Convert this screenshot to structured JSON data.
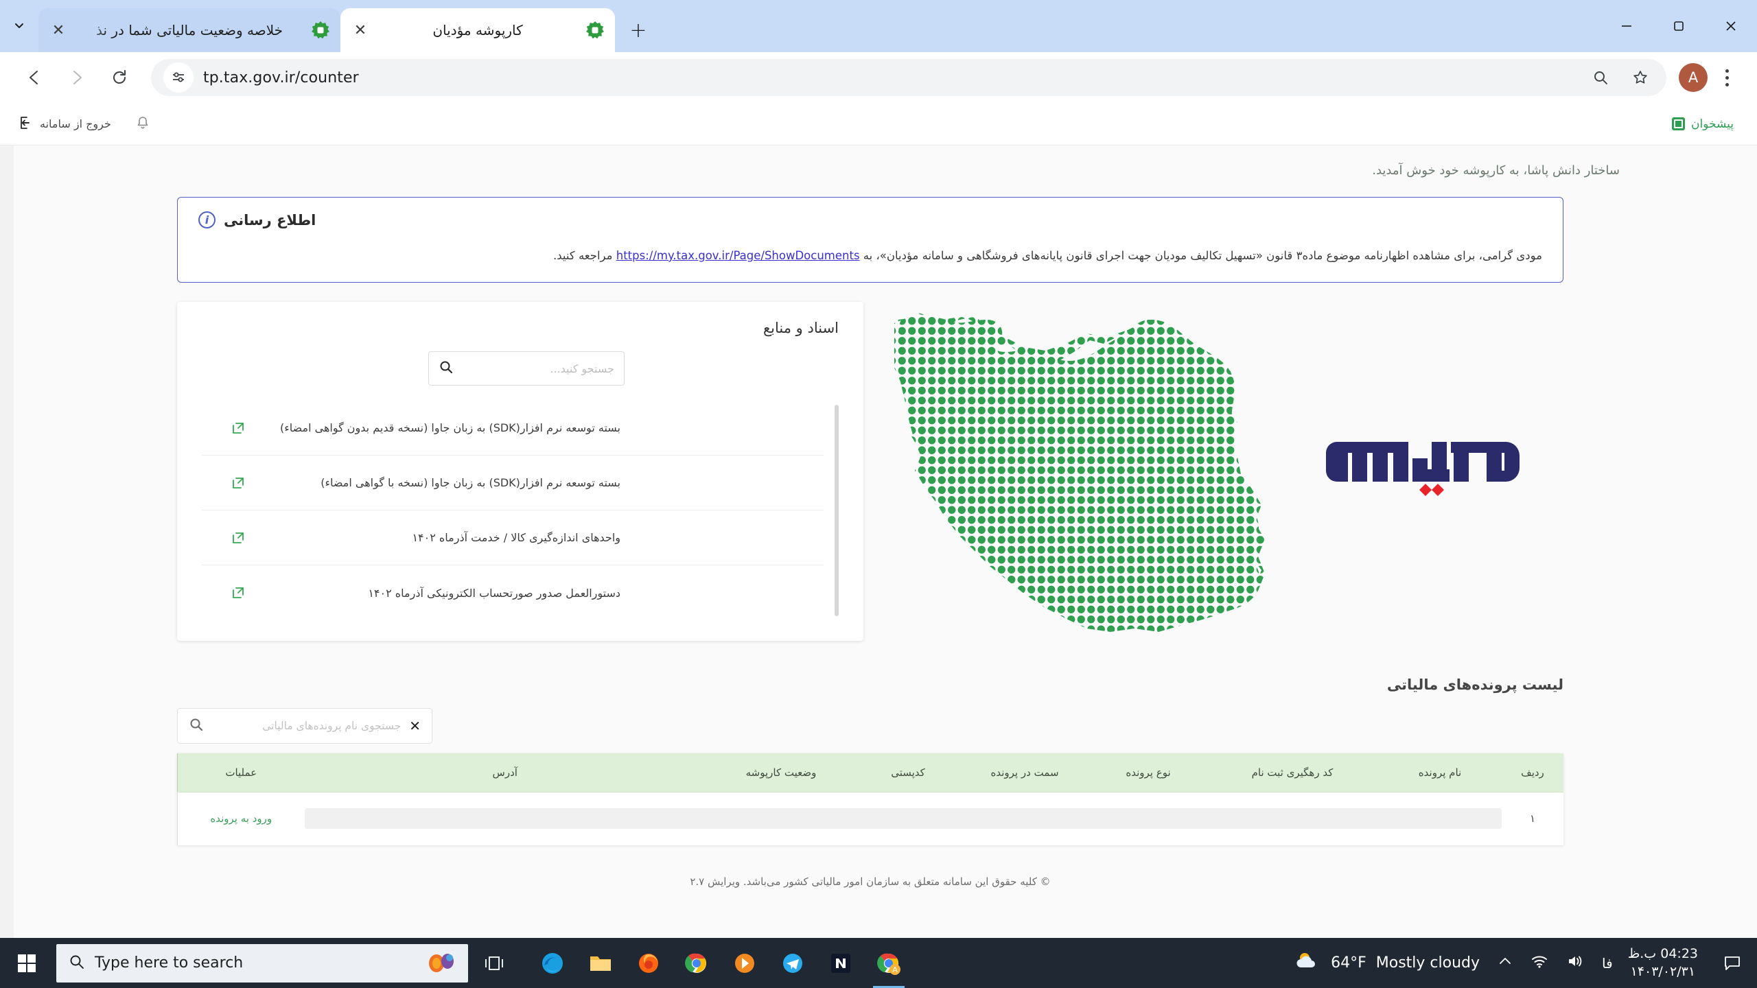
{
  "browser": {
    "tabs": [
      {
        "title": "خلاصه وضعیت مالیاتی شما در نذ",
        "active": false,
        "favicon": "tax-gov-favicon"
      },
      {
        "title": "کارپوشه مؤدیان",
        "active": true,
        "favicon": "tax-gov-favicon"
      }
    ],
    "new_tab_label": "+",
    "window_controls": {
      "minimize": "minimize-icon",
      "maximize": "maximize-icon",
      "close": "close-icon"
    },
    "omnibox": {
      "url": "tp.tax.gov.ir/counter",
      "site_settings_icon": "site-settings-icon"
    },
    "toolbar_icons": {
      "back": "back-arrow-icon",
      "forward": "forward-arrow-icon",
      "reload": "reload-icon",
      "zoom": "zoom-icon",
      "bookmark": "star-icon",
      "menu": "three-dot-menu-icon"
    },
    "profile_initial": "A"
  },
  "app": {
    "header": {
      "brand_label": "پیشخوان",
      "logout_label": "خروج از سامانه",
      "bell_icon": "notification-bell-icon",
      "logout_icon": "logout-icon"
    },
    "welcome": {
      "user_name": "ساختار دانش پاشا",
      "text": "ساختار دانش پاشا، به کارپوشه خود خوش آمدید."
    },
    "notice": {
      "title": "اطلاع رسانی",
      "icon": "info-circle-icon",
      "text_before": "مودی گرامی، برای مشاهده اظهارنامه موضوع ماده۳ قانون «تسهیل تکالیف مودیان جهت اجرای قانون پایانه‌های فروشگاهی و سامانه مؤدیان»، به",
      "link": "https://my.tax.gov.ir/Page/ShowDocuments",
      "text_after": "مراجعه کنید."
    },
    "documents_card": {
      "title": "اسناد و منابع",
      "search_placeholder": "جستجو کنید...",
      "search_value": "",
      "search_icon": "search-icon",
      "items": [
        {
          "label": "بسته توسعه نرم افزار(SDK) به زبان جاوا (نسخه قدیم بدون گواهی امضاء)",
          "icon": "external-link-icon"
        },
        {
          "label": "بسته توسعه نرم افزار(SDK) به زبان جاوا (نسخه با گواهی امضاء)",
          "icon": "external-link-icon"
        },
        {
          "label": "واحدهای اندازه‌گیری کالا / خدمت آذرماه ۱۴۰۲",
          "icon": "external-link-icon"
        },
        {
          "label": "دستورالعمل صدور صورتحساب الکترونیکی آذرماه ۱۴۰۲",
          "icon": "external-link-icon"
        }
      ]
    },
    "graphics": {
      "map_name": "iran-dotted-map",
      "map_color": "#2f9e4f",
      "logo_name": "sepas-logo",
      "logo_color": "#2b2b6b",
      "logo_accent_color": "#e8232a"
    },
    "files_section": {
      "title": "لیست پرونده‌های مالیاتی",
      "search_placeholder": "جستجوی نام پرونده‌های مالیاتی",
      "search_value": "",
      "search_icon": "search-icon",
      "clear_icon": "clear-x-icon",
      "columns": [
        "ردیف",
        "نام پرونده",
        "کد رهگیری ثبت نام",
        "نوع پرونده",
        "سمت در پرونده",
        "کدپستی",
        "وضعیت کارپوشه",
        "آدرس",
        "عملیات"
      ],
      "rows": [
        {
          "index": "۱",
          "name": "",
          "tracking_code": "",
          "file_type": "",
          "role": "",
          "postal_code": "",
          "status": "",
          "address": "",
          "action": "ورود به پرونده"
        }
      ]
    },
    "footer": "© کلیه حقوق این سامانه متعلق به سازمان امور مالیاتی کشور می‌باشد. ویرایش ۲.۷"
  },
  "taskbar": {
    "start_icon": "windows-start-icon",
    "search_placeholder": "Type here to search",
    "search_icon": "search-icon",
    "taskview_icon": "task-view-icon",
    "apps": [
      {
        "name": "microsoft-edge-icon"
      },
      {
        "name": "file-explorer-icon"
      },
      {
        "name": "firefox-icon"
      },
      {
        "name": "google-chrome-icon"
      },
      {
        "name": "vlc-media-player-icon"
      },
      {
        "name": "telegram-icon"
      },
      {
        "name": "notion-icon"
      },
      {
        "name": "chrome-active-window-icon"
      }
    ],
    "weather": {
      "temperature": "64°F",
      "condition": "Mostly cloudy",
      "icon": "partly-cloudy-icon"
    },
    "tray": {
      "chevron": "show-hidden-icons-icon",
      "wifi": "wifi-icon",
      "volume": "volume-icon",
      "language": "فا"
    },
    "clock": {
      "time": "04:23 ب.ظ",
      "date": "۱۴۰۳/۰۲/۳۱"
    },
    "notification_icon": "action-center-icon"
  }
}
